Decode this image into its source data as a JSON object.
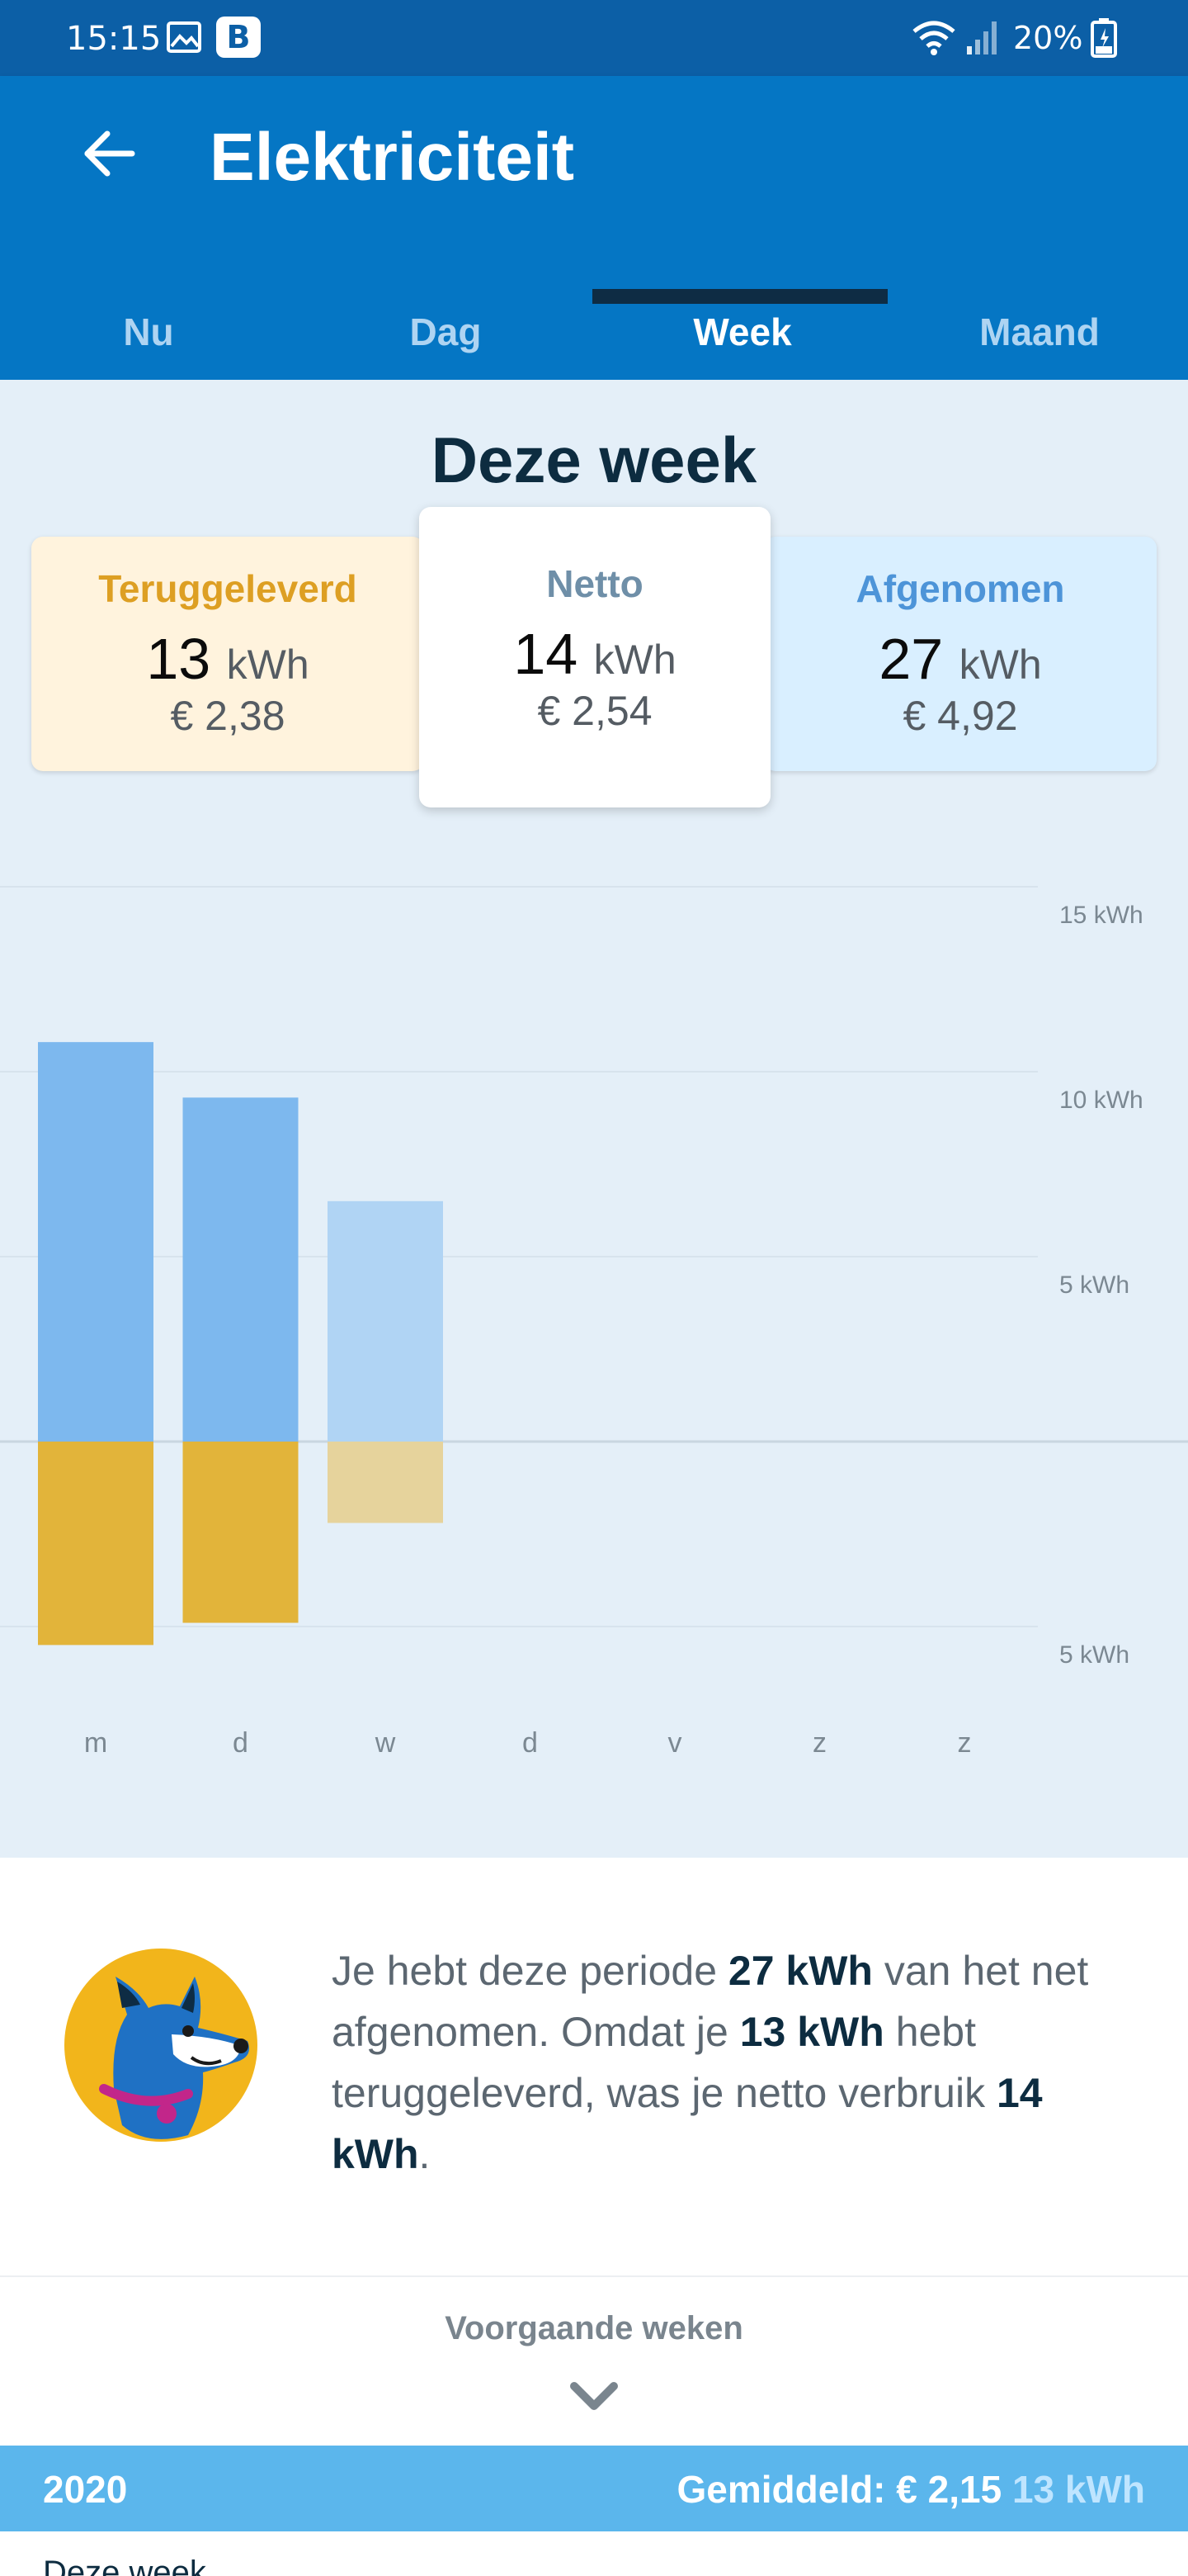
{
  "status_bar": {
    "time": "15:15",
    "battery": "20%",
    "icons": [
      "image-icon",
      "b-app-icon",
      "wifi-icon",
      "signal-icon",
      "battery-icon"
    ]
  },
  "header": {
    "title": "Elektriciteit"
  },
  "tabs": [
    {
      "label": "Nu"
    },
    {
      "label": "Dag"
    },
    {
      "label": "Week",
      "active": true
    },
    {
      "label": "Maand"
    }
  ],
  "summary": {
    "title": "Deze week",
    "teruggeleverd": {
      "label": "Teruggeleverd",
      "kwh": "13",
      "unit": "kWh",
      "eur": "€ 2,38"
    },
    "netto": {
      "label": "Netto",
      "kwh": "14",
      "unit": "kWh",
      "eur": "€ 2,54"
    },
    "afgenomen": {
      "label": "Afgenomen",
      "kwh": "27",
      "unit": "kWh",
      "eur": "€ 4,92"
    }
  },
  "chart_data": {
    "type": "bar",
    "categories": [
      "m",
      "d",
      "w",
      "d",
      "v",
      "z",
      "z"
    ],
    "series": [
      {
        "values": [
          10.8,
          9.3,
          6.5,
          null,
          null,
          null,
          null
        ]
      },
      {
        "values": [
          -5.5,
          -4.9,
          -2.2,
          null,
          null,
          null,
          null
        ]
      }
    ],
    "y_tick_labels": [
      "15 kWh",
      "10 kWh",
      "5 kWh",
      "5 kWh"
    ],
    "ylim": [
      -5,
      15
    ],
    "colors": {
      "afgenomen": "#7db8ee",
      "afgenomen_partial": "#b0d4f4",
      "teruggeleverd": "#e2b43a",
      "teruggeleverd_partial": "#e6d39c"
    },
    "current_day_index": 2
  },
  "info": {
    "t1": "Je hebt deze periode ",
    "b1": "27 kWh",
    "t2": " van het net afgenomen. Omdat je ",
    "b2": "13 kWh",
    "t3": " hebt teruggeleverd, was je netto verbruik ",
    "b3": "14 kWh",
    "t4": "."
  },
  "previous": {
    "label": "Voorgaande weken"
  },
  "year_bar": {
    "year": "2020",
    "avg_label": "Gemiddeld: € 2,15",
    "avg_kwh": "13 kWh"
  },
  "next_row": {
    "label": "Deze week"
  }
}
